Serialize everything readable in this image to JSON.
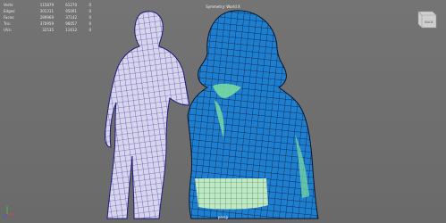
{
  "viewport": {
    "title": "Symmetry: World X",
    "camera": "persp",
    "camera_prefix": "",
    "hud": [
      {
        "label": "Verts:",
        "v1": "115879",
        "v2": "61270",
        "v3": "0"
      },
      {
        "label": "Edges:",
        "v1": "301311",
        "v2": "95091",
        "v3": "0"
      },
      {
        "label": "Faces:",
        "v1": "289969",
        "v2": "37142",
        "v3": "0"
      },
      {
        "label": "Tris:",
        "v1": "370959",
        "v2": "96057",
        "v3": "0"
      },
      {
        "label": "UVs:",
        "v1": "32535",
        "v2": "11612",
        "v3": "0"
      }
    ],
    "viewcube_label": "BACK"
  },
  "colors": {
    "background": "#6f6f6f",
    "left_model": "#d8d4ec",
    "left_wire": "#2d2a9c",
    "right_model": "#1e7fd0",
    "right_wire": "#0a1630",
    "selection": "#7ee0a0"
  },
  "icons": [
    "view-cube-icon",
    "axis-gizmo-icon"
  ]
}
